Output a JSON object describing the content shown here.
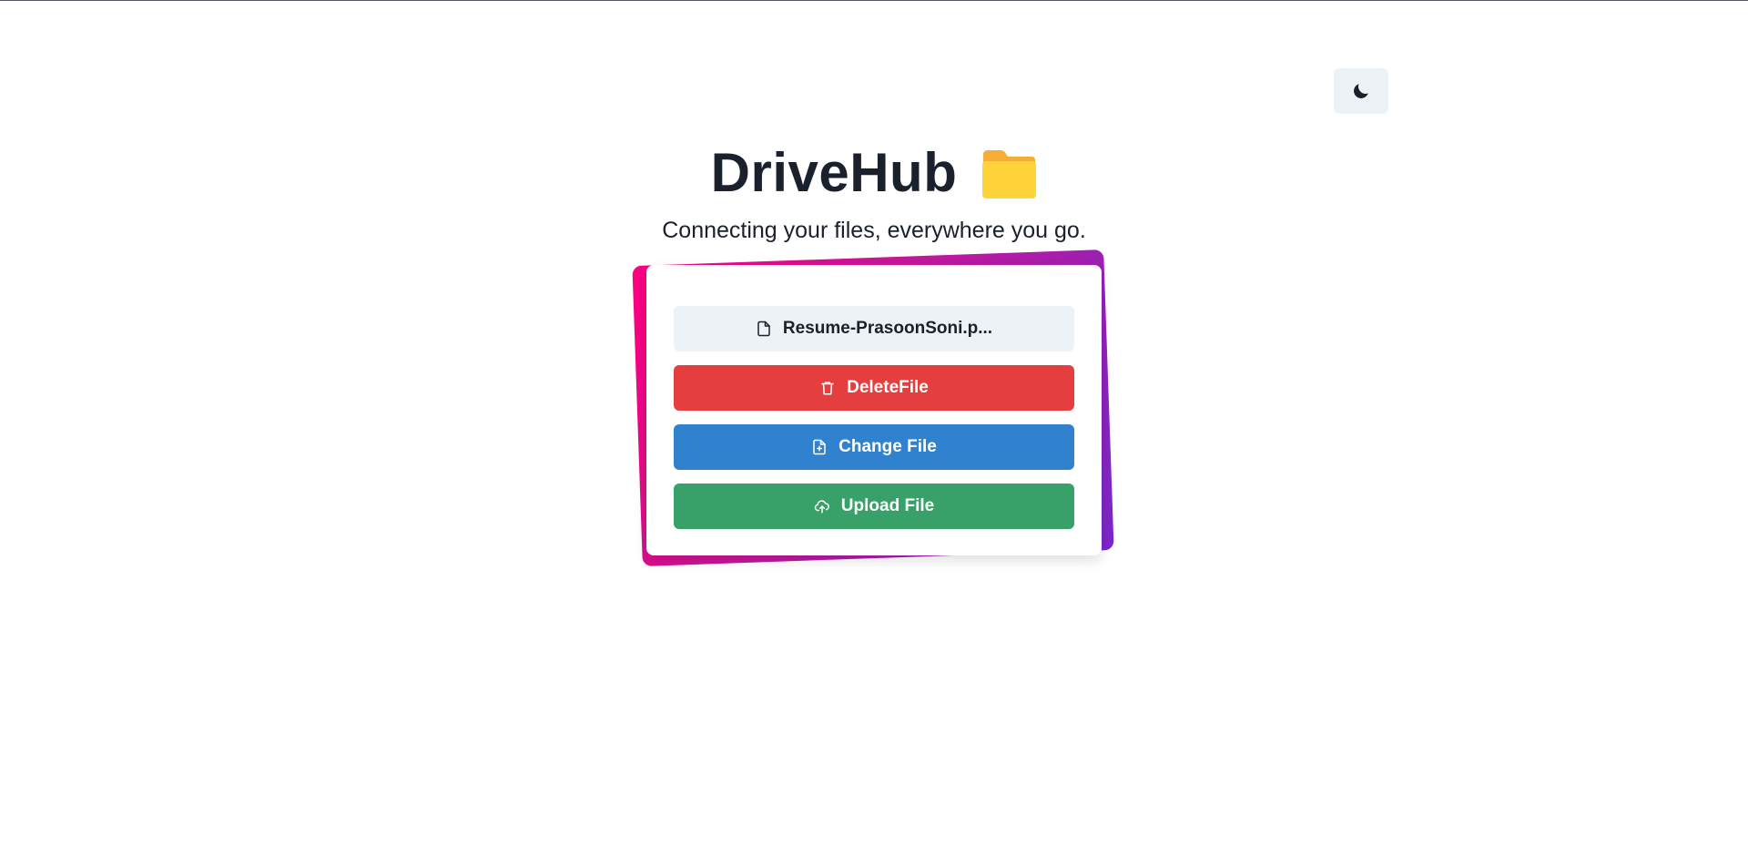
{
  "app": {
    "title": "DriveHub",
    "title_icon": "folder-icon",
    "subtitle": "Connecting your files, everywhere you go."
  },
  "header": {
    "theme_toggle_icon": "moon-icon"
  },
  "card": {
    "file_button": {
      "label": "Resume-PrasoonSoni.p...",
      "icon": "file-icon"
    },
    "delete_button": {
      "label": "DeleteFile",
      "icon": "trash-icon"
    },
    "change_button": {
      "label": "Change File",
      "icon": "file-plus-icon"
    },
    "upload_button": {
      "label": "Upload File",
      "icon": "cloud-upload-icon"
    }
  },
  "colors": {
    "title_text": "#1a202c",
    "file_button_bg": "#edf2f7",
    "delete_bg": "#e53e3e",
    "change_bg": "#3182ce",
    "upload_bg": "#38a169",
    "gradient_start": "#ff0080",
    "gradient_end": "#7928ca",
    "folder_front": "#ffd43b",
    "folder_back": "#f6ad35"
  }
}
